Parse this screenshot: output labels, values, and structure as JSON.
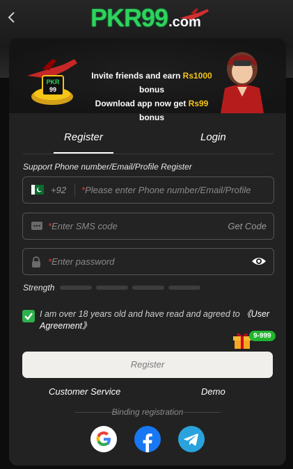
{
  "header": {
    "logo_main": "PKR99",
    "logo_suffix": ".com"
  },
  "banner": {
    "line1_prefix": "Invite friends and earn ",
    "line1_amount": "Rs1000",
    "line1_suffix": " bonus",
    "line2_prefix": "Download app now get ",
    "line2_amount": "Rs99",
    "line2_suffix": " bonus",
    "badge_text": "PKR 99"
  },
  "tabs": [
    {
      "label": "Register",
      "active": true
    },
    {
      "label": "Login",
      "active": false
    }
  ],
  "form": {
    "section_label": "Support Phone number/Email/Profile Register",
    "country_code": "+92",
    "phone_placeholder": "Please enter Phone number/Email/Profile",
    "sms_placeholder": "Enter SMS code",
    "get_code_label": "Get Code",
    "password_placeholder": "Enter password",
    "strength_label": "Strength",
    "agreement_text": "I am over 18 years old and have read and agreed to ",
    "agreement_link": "《User Agreement》",
    "agreement_checked": true,
    "gift_badge": "9-999",
    "register_button": "Register"
  },
  "links": {
    "customer_service": "Customer Service",
    "demo": "Demo"
  },
  "binding": {
    "label": "Binding registration",
    "providers": [
      "google-icon",
      "facebook-icon",
      "telegram-icon"
    ]
  },
  "colors": {
    "brand_green": "#2fd35a",
    "bonus_gold": "#f5c518",
    "checkbox_green": "#2db14d",
    "required_red": "#e53935"
  }
}
